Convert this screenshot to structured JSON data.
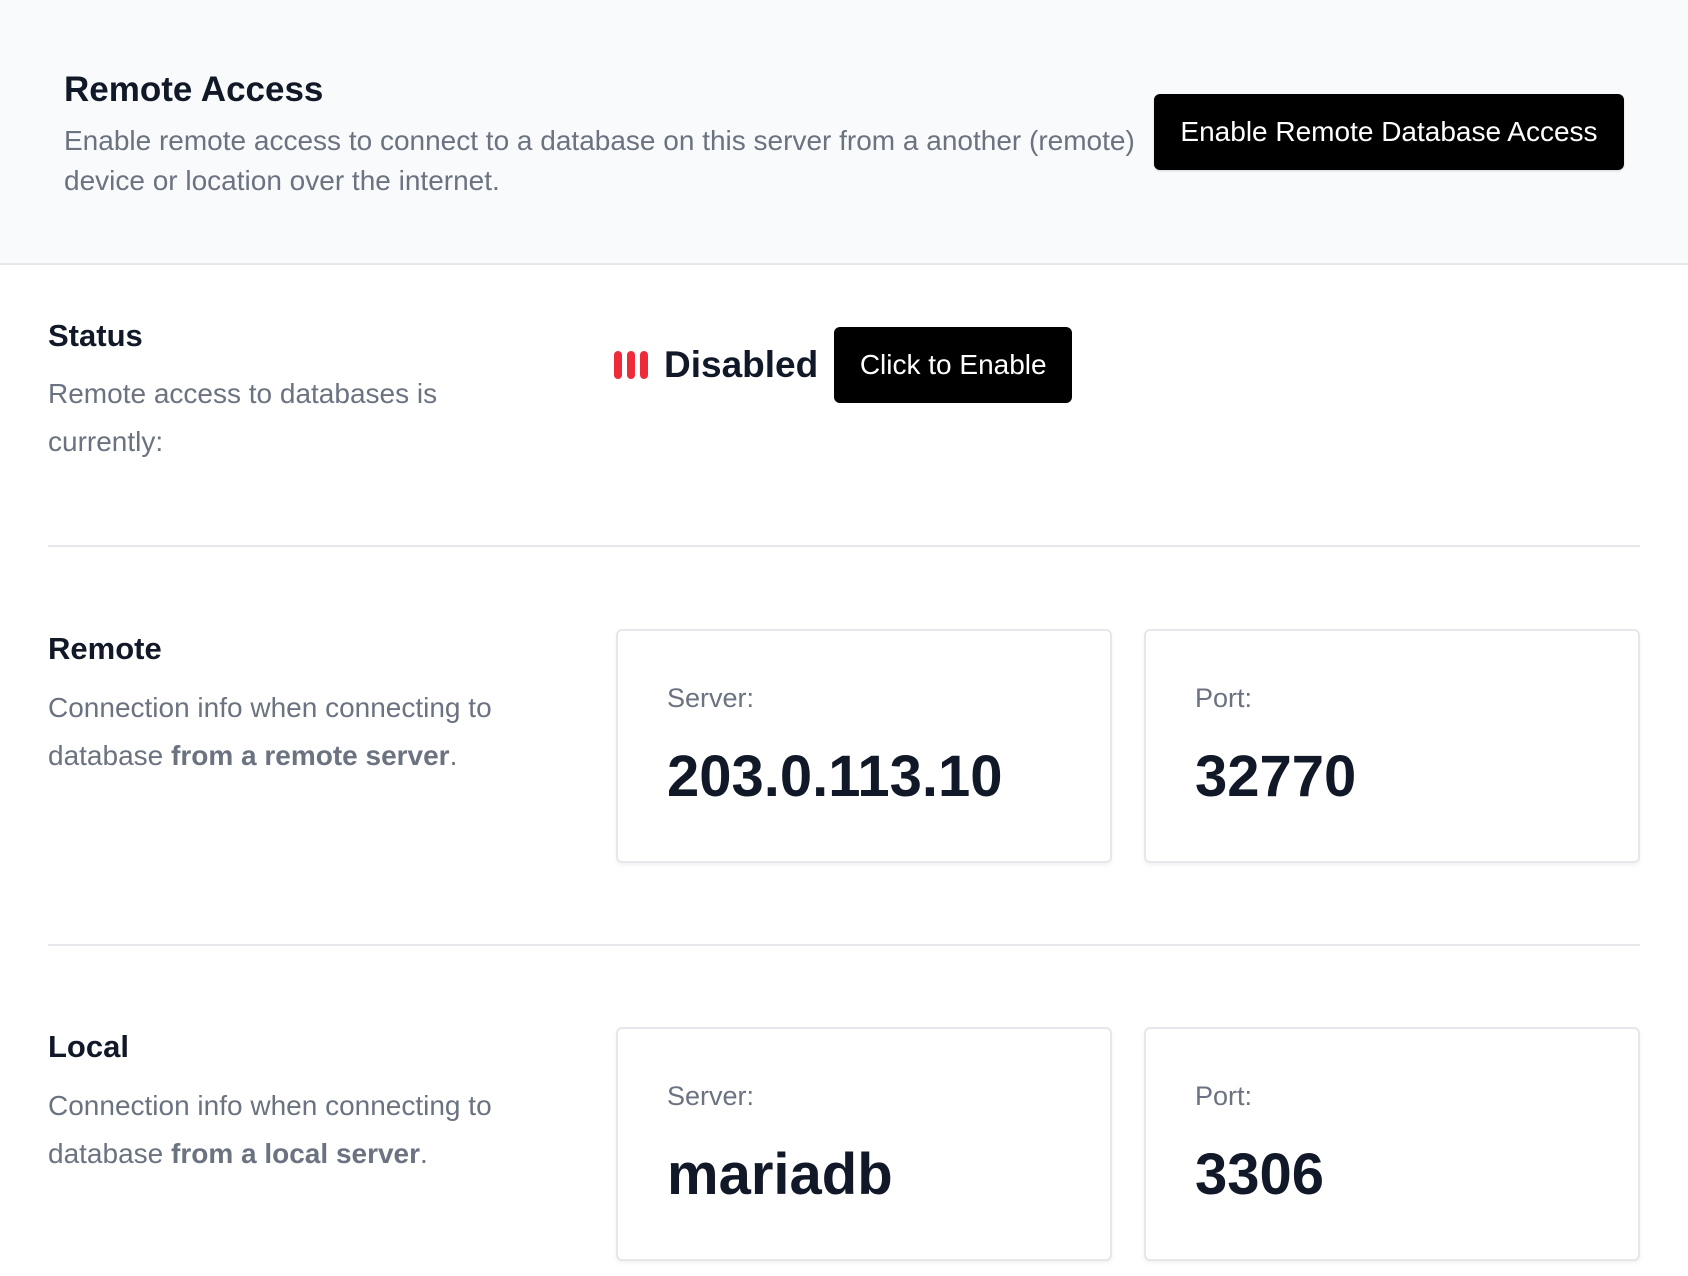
{
  "header": {
    "title": "Remote Access",
    "description": "Enable remote access to connect to a database on this server from a another (remote) device or location over the internet.",
    "enable_button_label": "Enable Remote Database Access"
  },
  "status": {
    "title": "Status",
    "description": "Remote access to databases is currently:",
    "value": "Disabled",
    "status_color": "#ef2b39",
    "enable_button_label": "Click to Enable"
  },
  "remote": {
    "title": "Remote",
    "description_prefix": "Connection info when connecting to database ",
    "description_bold": "from a remote server",
    "description_suffix": ".",
    "server_label": "Server:",
    "server_value": "203.0.113.10",
    "port_label": "Port:",
    "port_value": "32770"
  },
  "local": {
    "title": "Local",
    "description_prefix": "Connection info when connecting to database ",
    "description_bold": "from a local server",
    "description_suffix": ".",
    "server_label": "Server:",
    "server_value": "mariadb",
    "port_label": "Port:",
    "port_value": "3306"
  }
}
